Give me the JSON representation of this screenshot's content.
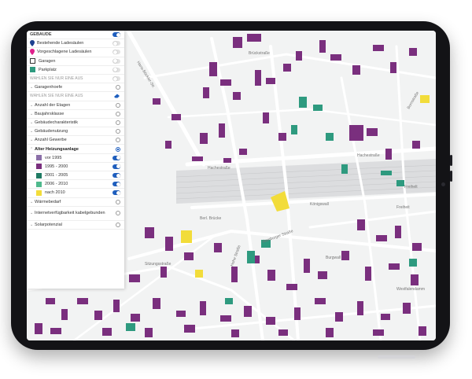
{
  "panel": {
    "header": "GEBÄUDE",
    "items": [
      {
        "label": "Bestehende Ladesäulen",
        "icon": "charging-pin-icon",
        "color": "#1b3f8f"
      },
      {
        "label": "Vorgeschlagene Ladesäulen",
        "icon": "proposed-pin-icon",
        "color": "#e0208c"
      },
      {
        "label": "Garagen",
        "icon": "garage-swatch-icon",
        "color": "#ffffff"
      },
      {
        "label": "Parkplatz",
        "icon": "parking-swatch-icon",
        "color": "#2e9a7f"
      }
    ],
    "section1": "WÄHLEN SIE NUR EINE AUS",
    "garagenhoefe": "Garagenhoefe",
    "section2": "WÄHLEN SIE NUR EINE AUS",
    "options": [
      "Anzahl der Etagen",
      "Baujahrsklasse",
      "Gebäudecharakteristik",
      "Gebäudenutzung",
      "Anzahl Gewerbe"
    ],
    "active_option": "Alter Heizungsanlage",
    "legend": [
      {
        "label": "vor 1995",
        "color": "#8b6fa8"
      },
      {
        "label": "1995 - 2000",
        "color": "#7a2f7e"
      },
      {
        "label": "2001 - 2005",
        "color": "#1f7a63"
      },
      {
        "label": "2006 - 2010",
        "color": "#4fb98d"
      },
      {
        "label": "nach 2010",
        "color": "#f2dc3a"
      }
    ],
    "more_options": [
      "Wärmebedarf",
      "Internetverfügbarkeit kabelgebunden",
      "Solarpotenzial"
    ]
  },
  "map": {
    "street_labels": [
      "Brückstraße",
      "Hans-Böckler-Str.",
      "Hachestraße",
      "Hachestraße",
      "Bornstraße",
      "Freihelt",
      "Freiheit",
      "Königswall",
      "Hamburger Straße",
      "Hohe Straße",
      "Berl. Brücke",
      "Sitzungsstraße",
      "Burgwall",
      "Westfalendamm"
    ],
    "colors": {
      "base": "#f2f3f3",
      "road": "#ffffff",
      "rail": "#d9dadb",
      "purple": "#7a2f7e",
      "teal": "#2e9a7f",
      "yellow": "#f2dc3a"
    }
  }
}
